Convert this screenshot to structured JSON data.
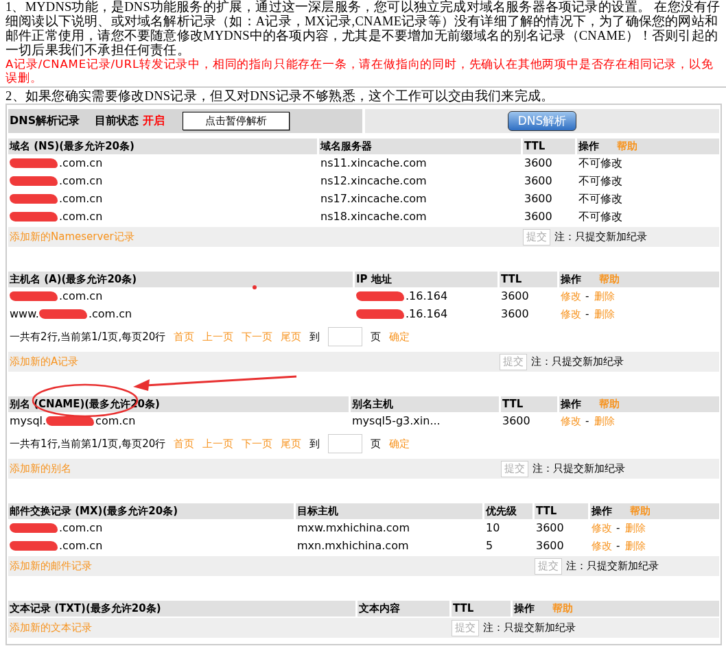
{
  "intro": {
    "paragraph": "1、MYDNS功能，是DNS功能服务的扩展，通过这一深层服务，您可以独立完成对域名服务器各项记录的设置。 在您没有仔细阅读以下说明、或对域名解析记录（如：A记录，MX记录,CNAME记录等）没有详细了解的情况下，为了确保您的网站和邮件正常使用，请您不要随意修改MYDNS中的各项内容，尤其是不要增加无前缀域名的别名记录（CNAME）！否则引起的一切后果我们不承担任何责任。",
    "warning": "A记录/CNAME记录/URL转发记录中，相同的指向只能存在一条，请在做指向的同时，先确认在其他两项中是否存在相同记录，以免误删。",
    "note": "2、如果您确实需要修改DNS记录，但又对DNS记录不够熟悉，这个工作可以交由我们来完成。"
  },
  "status_bar": {
    "title": "DNS解析记录",
    "status_label": "目前状态",
    "status": "开启",
    "pause_button": "点击暂停解析",
    "dns_button": "DNS解析"
  },
  "sections": [
    {
      "kind": "ns",
      "columns": [
        "域名 (NS)(最多允许20条)",
        "域名服务器",
        "TTL",
        "操作"
      ],
      "help": "帮助",
      "rows": [
        [
          {
            "kind": "masked",
            "suffix": ".com.cn",
            "redacted": true
          },
          {
            "kind": "text",
            "text": "ns11.xincache.com"
          },
          {
            "kind": "text",
            "text": "3600"
          },
          {
            "kind": "locked",
            "text": "不可修改"
          }
        ],
        [
          {
            "kind": "masked",
            "suffix": ".com.cn",
            "redacted": true
          },
          {
            "kind": "text",
            "text": "ns12.xincache.com"
          },
          {
            "kind": "text",
            "text": "3600"
          },
          {
            "kind": "locked",
            "text": "不可修改"
          }
        ],
        [
          {
            "kind": "masked",
            "suffix": ".com.cn",
            "redacted": true
          },
          {
            "kind": "text",
            "text": "ns17.xincache.com"
          },
          {
            "kind": "text",
            "text": "3600"
          },
          {
            "kind": "locked",
            "text": "不可修改"
          }
        ],
        [
          {
            "kind": "masked",
            "suffix": ".com.cn",
            "redacted": true
          },
          {
            "kind": "text",
            "text": "ns18.xincache.com"
          },
          {
            "kind": "text",
            "text": "3600"
          },
          {
            "kind": "locked",
            "text": "不可修改"
          }
        ]
      ],
      "add": {
        "link": "添加新的Nameserver记录",
        "submit": "提交",
        "disabled": true,
        "note": "注：只提交新加纪录"
      }
    },
    {
      "kind": "a",
      "columns": [
        "主机名 (A)(最多允许20条)",
        "IP 地址",
        "TTL",
        "操作"
      ],
      "help": "帮助",
      "rows": [
        [
          {
            "kind": "masked",
            "suffix": ".com.cn",
            "redacted": true
          },
          {
            "kind": "masked",
            "suffix": ".16.164",
            "redacted": true
          },
          {
            "kind": "text",
            "text": "3600"
          },
          {
            "kind": "actions",
            "edit": "修改",
            "sep": "-",
            "delete": "删除"
          }
        ],
        [
          {
            "kind": "masked",
            "prefix": "www.",
            "suffix": ".com.cn",
            "redacted": true
          },
          {
            "kind": "masked",
            "suffix": ".16.164",
            "redacted": true
          },
          {
            "kind": "text",
            "text": "3600"
          },
          {
            "kind": "actions",
            "edit": "修改",
            "sep": "-",
            "delete": "删除"
          }
        ]
      ],
      "pager": {
        "summary": "一共有2行,当前第1/1页,每页20行",
        "links": [
          "首页",
          "上一页",
          "下一页",
          "尾页"
        ],
        "goto": "到",
        "unit": "页",
        "confirm": "确定"
      },
      "add": {
        "link": "添加新的A记录",
        "submit": "提交",
        "disabled": true,
        "note": "注：只提交新加纪录"
      }
    },
    {
      "kind": "cname",
      "columns": [
        "别名 (CNAME)(最多允许20条)",
        "别名主机",
        "TTL",
        "操作"
      ],
      "help": "帮助",
      "annotated": true,
      "rows": [
        [
          {
            "kind": "masked",
            "prefix": "mysql.",
            "suffix": "com.cn",
            "redacted": true
          },
          {
            "kind": "text",
            "text": "mysql5-g3.xin..."
          },
          {
            "kind": "text",
            "text": "3600"
          },
          {
            "kind": "actions",
            "edit": "修改",
            "sep": "-",
            "delete": "删除"
          }
        ]
      ],
      "pager": {
        "summary": "一共有1行,当前第1/1页,每页20行",
        "links": [
          "首页",
          "上一页",
          "下一页",
          "尾页"
        ],
        "goto": "到",
        "unit": "页",
        "confirm": "确定"
      },
      "add": {
        "link": "添加新的别名",
        "submit": "提交",
        "disabled": true,
        "note": "注：只提交新加纪录"
      }
    },
    {
      "kind": "mx",
      "columns": [
        "邮件交换记录 (MX)(最多允许20条)",
        "目标主机",
        "优先级",
        "TTL",
        "操作"
      ],
      "help": "帮助",
      "rows": [
        [
          {
            "kind": "masked",
            "suffix": ".com.cn",
            "redacted": true
          },
          {
            "kind": "text",
            "text": "mxw.mxhichina.com"
          },
          {
            "kind": "text",
            "text": "10"
          },
          {
            "kind": "text",
            "text": "3600"
          },
          {
            "kind": "actions",
            "edit": "修改",
            "sep": "-",
            "delete": "删除"
          }
        ],
        [
          {
            "kind": "masked",
            "suffix": ".com.cn",
            "redacted": true
          },
          {
            "kind": "text",
            "text": "mxn.mxhichina.com"
          },
          {
            "kind": "text",
            "text": "5"
          },
          {
            "kind": "text",
            "text": "3600"
          },
          {
            "kind": "actions",
            "edit": "修改",
            "sep": "-",
            "delete": "删除"
          }
        ]
      ],
      "add": {
        "link": "添加新的邮件记录",
        "submit": "提交",
        "disabled": true,
        "note": "注：只提交新加纪录"
      }
    },
    {
      "kind": "txt",
      "columns": [
        "文本记录 (TXT)(最多允许20条)",
        "文本内容",
        "TTL",
        "操作"
      ],
      "help": "帮助",
      "add": {
        "link": "添加新的文本记录",
        "submit": "提交",
        "disabled": true,
        "note": "注：只提交新加纪录"
      }
    }
  ]
}
